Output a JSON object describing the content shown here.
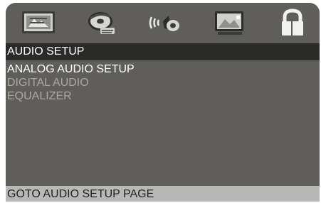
{
  "icons": [
    {
      "name": "general-setup-icon"
    },
    {
      "name": "video-disc-icon"
    },
    {
      "name": "audio-speaker-icon"
    },
    {
      "name": "video-display-icon"
    },
    {
      "name": "lock-icon"
    }
  ],
  "header": {
    "title": "AUDIO SETUP"
  },
  "menu": {
    "items": [
      {
        "label": "ANALOG AUDIO SETUP",
        "active": true
      },
      {
        "label": "DIGITAL AUDIO",
        "active": false
      },
      {
        "label": "EQUALIZER",
        "active": false
      }
    ]
  },
  "status": {
    "text": "GOTO AUDIO SETUP PAGE"
  },
  "colors": {
    "panel": "#5f5e5a",
    "title_bar": "#2a2a29",
    "status_bar": "#b8b8b6",
    "menu_active": "#ffffff",
    "menu_inactive": "#a9a8a2"
  }
}
